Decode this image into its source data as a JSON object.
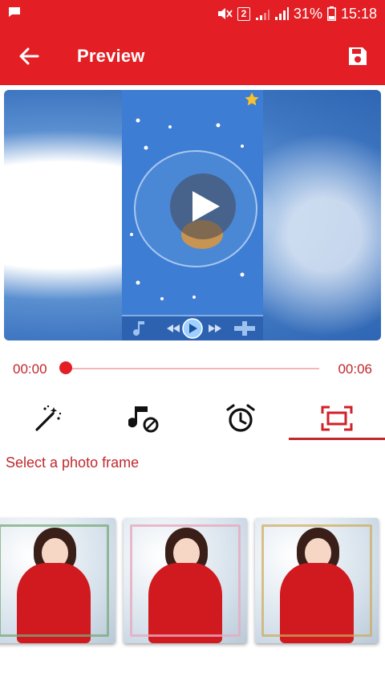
{
  "status_bar": {
    "sim_slot": "2",
    "battery": "31%",
    "time": "15:18"
  },
  "app_bar": {
    "title": "Preview"
  },
  "player": {
    "current_time": "00:00",
    "total_time": "00:06",
    "progress": 0
  },
  "tabs": [
    {
      "icon": "magic-wand-icon"
    },
    {
      "icon": "music-note-icon"
    },
    {
      "icon": "alarm-clock-icon"
    },
    {
      "icon": "photo-frame-icon",
      "active": true
    }
  ],
  "frame_section": {
    "label": "Select a photo frame"
  },
  "colors": {
    "accent": "#e31e24",
    "accent_text": "#c0282e"
  }
}
